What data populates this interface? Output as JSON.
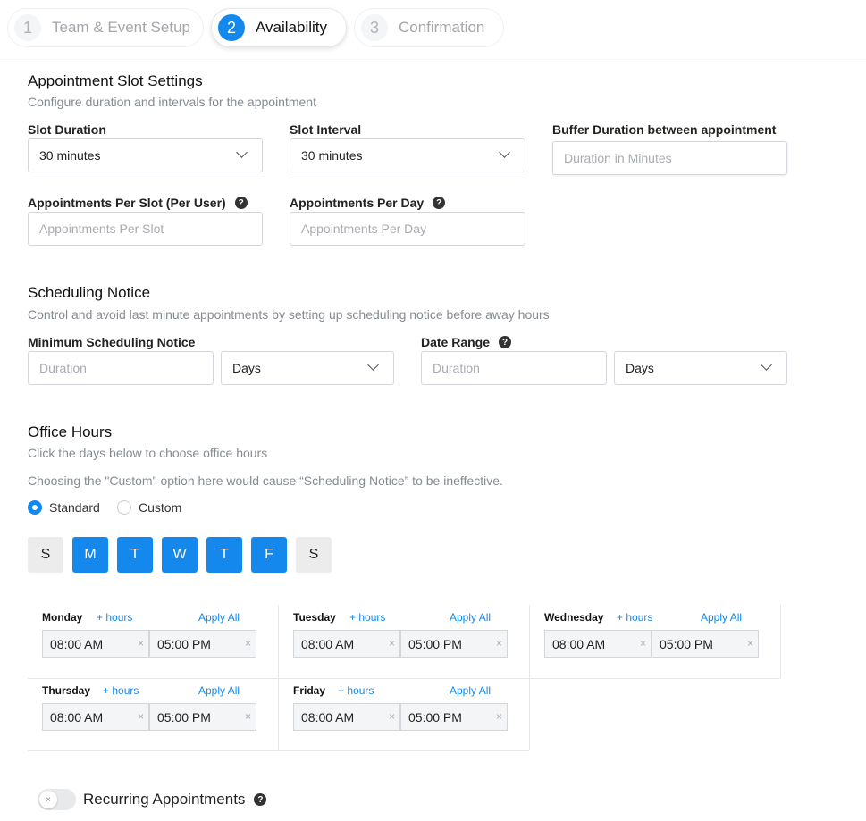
{
  "stepper": {
    "steps": [
      {
        "num": "1",
        "label": "Team & Event Setup"
      },
      {
        "num": "2",
        "label": "Availability"
      },
      {
        "num": "3",
        "label": "Confirmation"
      }
    ],
    "active_index": 1
  },
  "slot_settings": {
    "title": "Appointment Slot Settings",
    "subtitle": "Configure duration and intervals for the appointment",
    "slot_duration": {
      "label": "Slot Duration",
      "value": "30 minutes"
    },
    "slot_interval": {
      "label": "Slot Interval",
      "value": "30 minutes"
    },
    "buffer": {
      "label": "Buffer Duration between appointment",
      "placeholder": "Duration in Minutes"
    },
    "per_slot": {
      "label": "Appointments Per Slot (Per User)",
      "placeholder": "Appointments Per Slot"
    },
    "per_day": {
      "label": "Appointments Per Day",
      "placeholder": "Appointments Per Day"
    },
    "help_glyph": "?"
  },
  "scheduling_notice": {
    "title": "Scheduling Notice",
    "subtitle": "Control and avoid last minute appointments by setting up scheduling notice before away hours",
    "min_notice": {
      "label": "Minimum Scheduling Notice",
      "placeholder": "Duration",
      "unit": "Days"
    },
    "date_range": {
      "label": "Date Range",
      "placeholder": "Duration",
      "unit": "Days"
    }
  },
  "office_hours": {
    "title": "Office Hours",
    "subtitle": "Click the days below to choose office hours",
    "warning": "Choosing the \"Custom\" option here would cause “Scheduling Notice” to be ineffective.",
    "radio_standard": "Standard",
    "radio_custom": "Custom",
    "selected": "Standard",
    "day_buttons": [
      {
        "letter": "S",
        "selected": false
      },
      {
        "letter": "M",
        "selected": true
      },
      {
        "letter": "T",
        "selected": true
      },
      {
        "letter": "W",
        "selected": true
      },
      {
        "letter": "T",
        "selected": true
      },
      {
        "letter": "F",
        "selected": true
      },
      {
        "letter": "S",
        "selected": false
      }
    ],
    "add_hours_label": "+ hours",
    "apply_all_label": "Apply All",
    "clear_glyph": "×",
    "days": [
      {
        "name": "Monday",
        "start": "08:00 AM",
        "end": "05:00 PM"
      },
      {
        "name": "Tuesday",
        "start": "08:00 AM",
        "end": "05:00 PM"
      },
      {
        "name": "Wednesday",
        "start": "08:00 AM",
        "end": "05:00 PM"
      },
      {
        "name": "Thursday",
        "start": "08:00 AM",
        "end": "05:00 PM"
      },
      {
        "name": "Friday",
        "start": "08:00 AM",
        "end": "05:00 PM"
      }
    ]
  },
  "recurring": {
    "label": "Recurring Appointments",
    "enabled": false,
    "toggle_glyph": "×"
  },
  "colors": {
    "accent": "#1488ec",
    "day_off_bg": "#ececec",
    "border": "#d3d6da"
  }
}
